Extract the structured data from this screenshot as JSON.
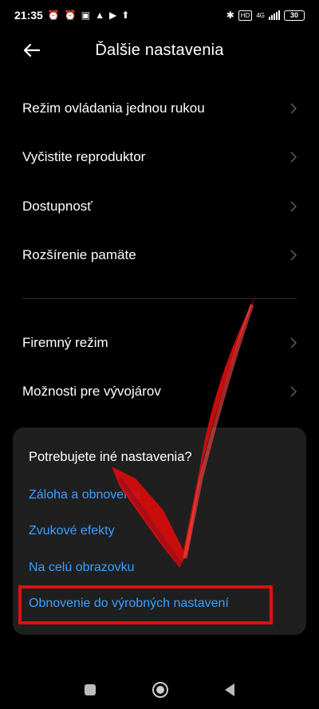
{
  "status_bar": {
    "time": "21:35",
    "network_badge": "4G",
    "battery": "30"
  },
  "header": {
    "title": "Ďalšie nastavenia"
  },
  "settings_group_1": [
    {
      "label": "Režim ovládania jednou rukou"
    },
    {
      "label": "Vyčistite reproduktor"
    },
    {
      "label": "Dostupnosť"
    },
    {
      "label": "Rozšírenie pamäte"
    }
  ],
  "settings_group_2": [
    {
      "label": "Firemný režim"
    },
    {
      "label": "Možnosti pre vývojárov"
    }
  ],
  "suggestions_card": {
    "question": "Potrebujete iné nastavenia?",
    "links": [
      {
        "label": "Záloha a obnovenie"
      },
      {
        "label": "Zvukové efekty"
      },
      {
        "label": "Na celú obrazovku"
      },
      {
        "label": "Obnovenie do výrobných nastavení"
      }
    ]
  },
  "colors": {
    "accent_link": "#3aa0ff",
    "annotation_red": "#e01010",
    "background": "#000000",
    "card": "#1f1f1f"
  }
}
